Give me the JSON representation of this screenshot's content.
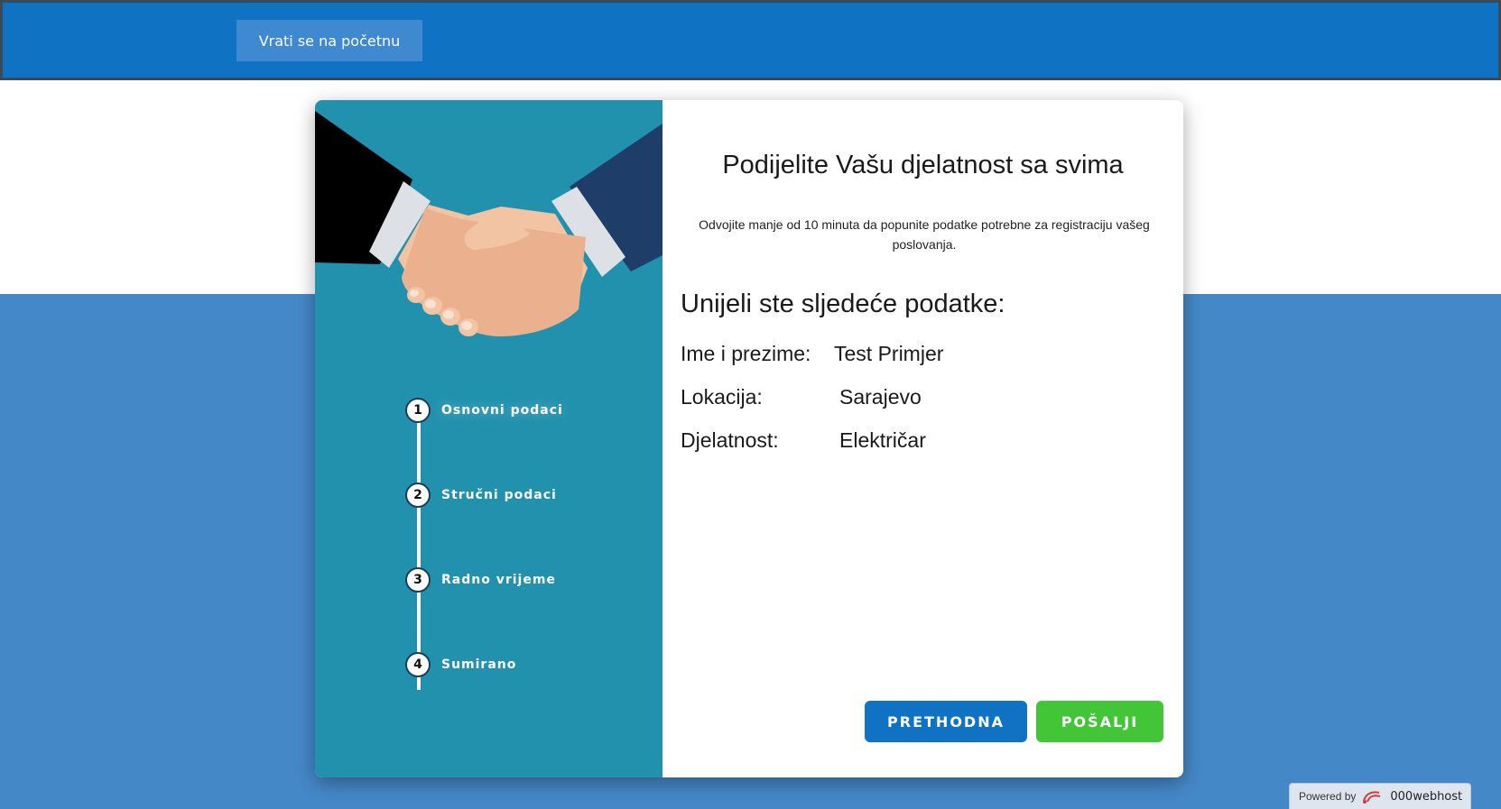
{
  "header": {
    "home_button": "Vrati se na početnu"
  },
  "steps": [
    {
      "num": "1",
      "label": "Osnovni podaci"
    },
    {
      "num": "2",
      "label": "Stručni podaci"
    },
    {
      "num": "3",
      "label": "Radno vrijeme"
    },
    {
      "num": "4",
      "label": "Sumirano"
    }
  ],
  "form": {
    "title": "Podijelite Vašu djelatnost sa svima",
    "subtitle": "Odvojite manje od 10 minuta da popunite podatke potrebne za registraciju vašeg poslovanja.",
    "summary_heading": "Unijeli ste sljedeće podatke:",
    "fields": [
      {
        "label": "Ime i prezime:",
        "value": "Test Primjer"
      },
      {
        "label": "Lokacija:",
        "value": "Sarajevo"
      },
      {
        "label": "Djelatnost:",
        "value": "Električar"
      }
    ],
    "prev_button": "PRETHODNA",
    "submit_button": "POŠALJI"
  },
  "footer": {
    "powered_by": "Powered by",
    "brand": "000webhost"
  },
  "colors": {
    "header_blue": "#0f72c2",
    "panel_teal": "#2291ae",
    "background_blue": "#4588c8",
    "submit_green": "#42c536"
  }
}
